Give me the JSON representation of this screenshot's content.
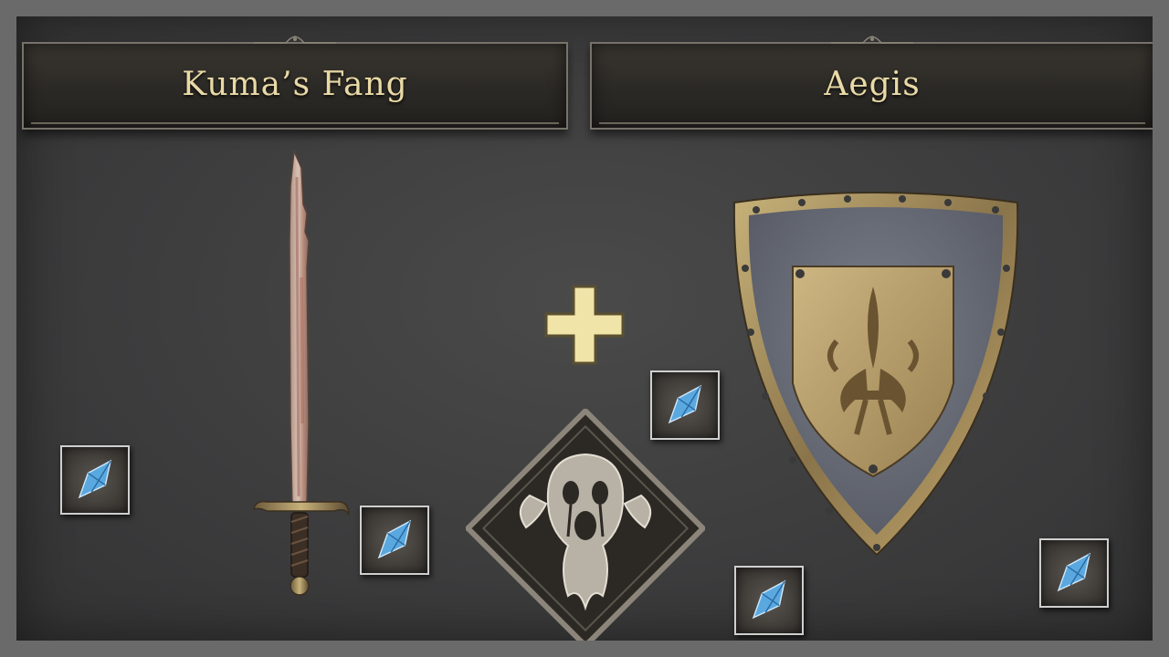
{
  "left_item": {
    "name": "Kuma’s Fang",
    "icon": "sword-icon"
  },
  "right_item": {
    "name": "Aegis",
    "icon": "shield-icon"
  },
  "combine_symbol": "plus-icon",
  "skill_icon": "screaming-ghost-skill-icon",
  "gem_slot_icon": "blue-crystal-icon",
  "colors": {
    "title_text": "#e9d9a6",
    "banner_bg": "#2b2925",
    "background": "#3d3d3e",
    "plus": "#f0e4a8",
    "crystal": "#5aa8e0"
  }
}
